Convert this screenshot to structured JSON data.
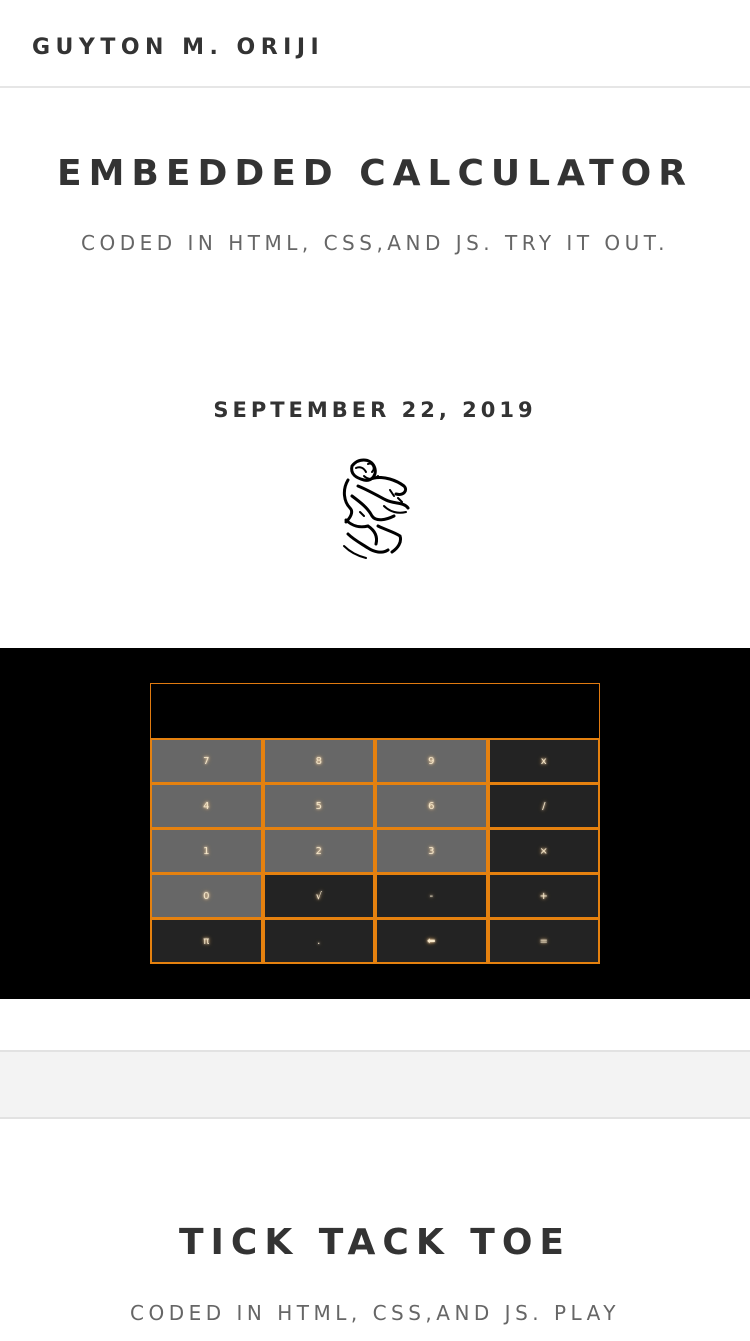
{
  "header": {
    "site_title": "GUYTON M. ORIJI"
  },
  "post1": {
    "title": "EMBEDDED CALCULATOR",
    "subtitle": "CODED IN HTML, CSS,AND JS. TRY IT OUT.",
    "date": "SEPTEMBER 22, 2019",
    "author_image": "author-sketch-portrait"
  },
  "calculator": {
    "display_value": "",
    "keys": [
      {
        "label": "7",
        "kind": "num"
      },
      {
        "label": "8",
        "kind": "num"
      },
      {
        "label": "9",
        "kind": "num"
      },
      {
        "label": "x",
        "kind": "op"
      },
      {
        "label": "4",
        "kind": "num"
      },
      {
        "label": "5",
        "kind": "num"
      },
      {
        "label": "6",
        "kind": "num"
      },
      {
        "label": "/",
        "kind": "op"
      },
      {
        "label": "1",
        "kind": "num"
      },
      {
        "label": "2",
        "kind": "num"
      },
      {
        "label": "3",
        "kind": "num"
      },
      {
        "label": "×",
        "kind": "op"
      },
      {
        "label": "0",
        "kind": "num"
      },
      {
        "label": "√",
        "kind": "op"
      },
      {
        "label": "-",
        "kind": "op"
      },
      {
        "label": "+",
        "kind": "op"
      },
      {
        "label": "π",
        "kind": "op"
      },
      {
        "label": ".",
        "kind": "op"
      },
      {
        "label": "⬅",
        "kind": "op"
      },
      {
        "label": "=",
        "kind": "op"
      }
    ],
    "accent_color": "#e5810f",
    "num_key_color": "#676767",
    "op_key_color": "#232323"
  },
  "post2": {
    "title": "TICK TACK TOE",
    "subtitle": "CODED IN HTML, CSS,AND JS. PLAY"
  }
}
